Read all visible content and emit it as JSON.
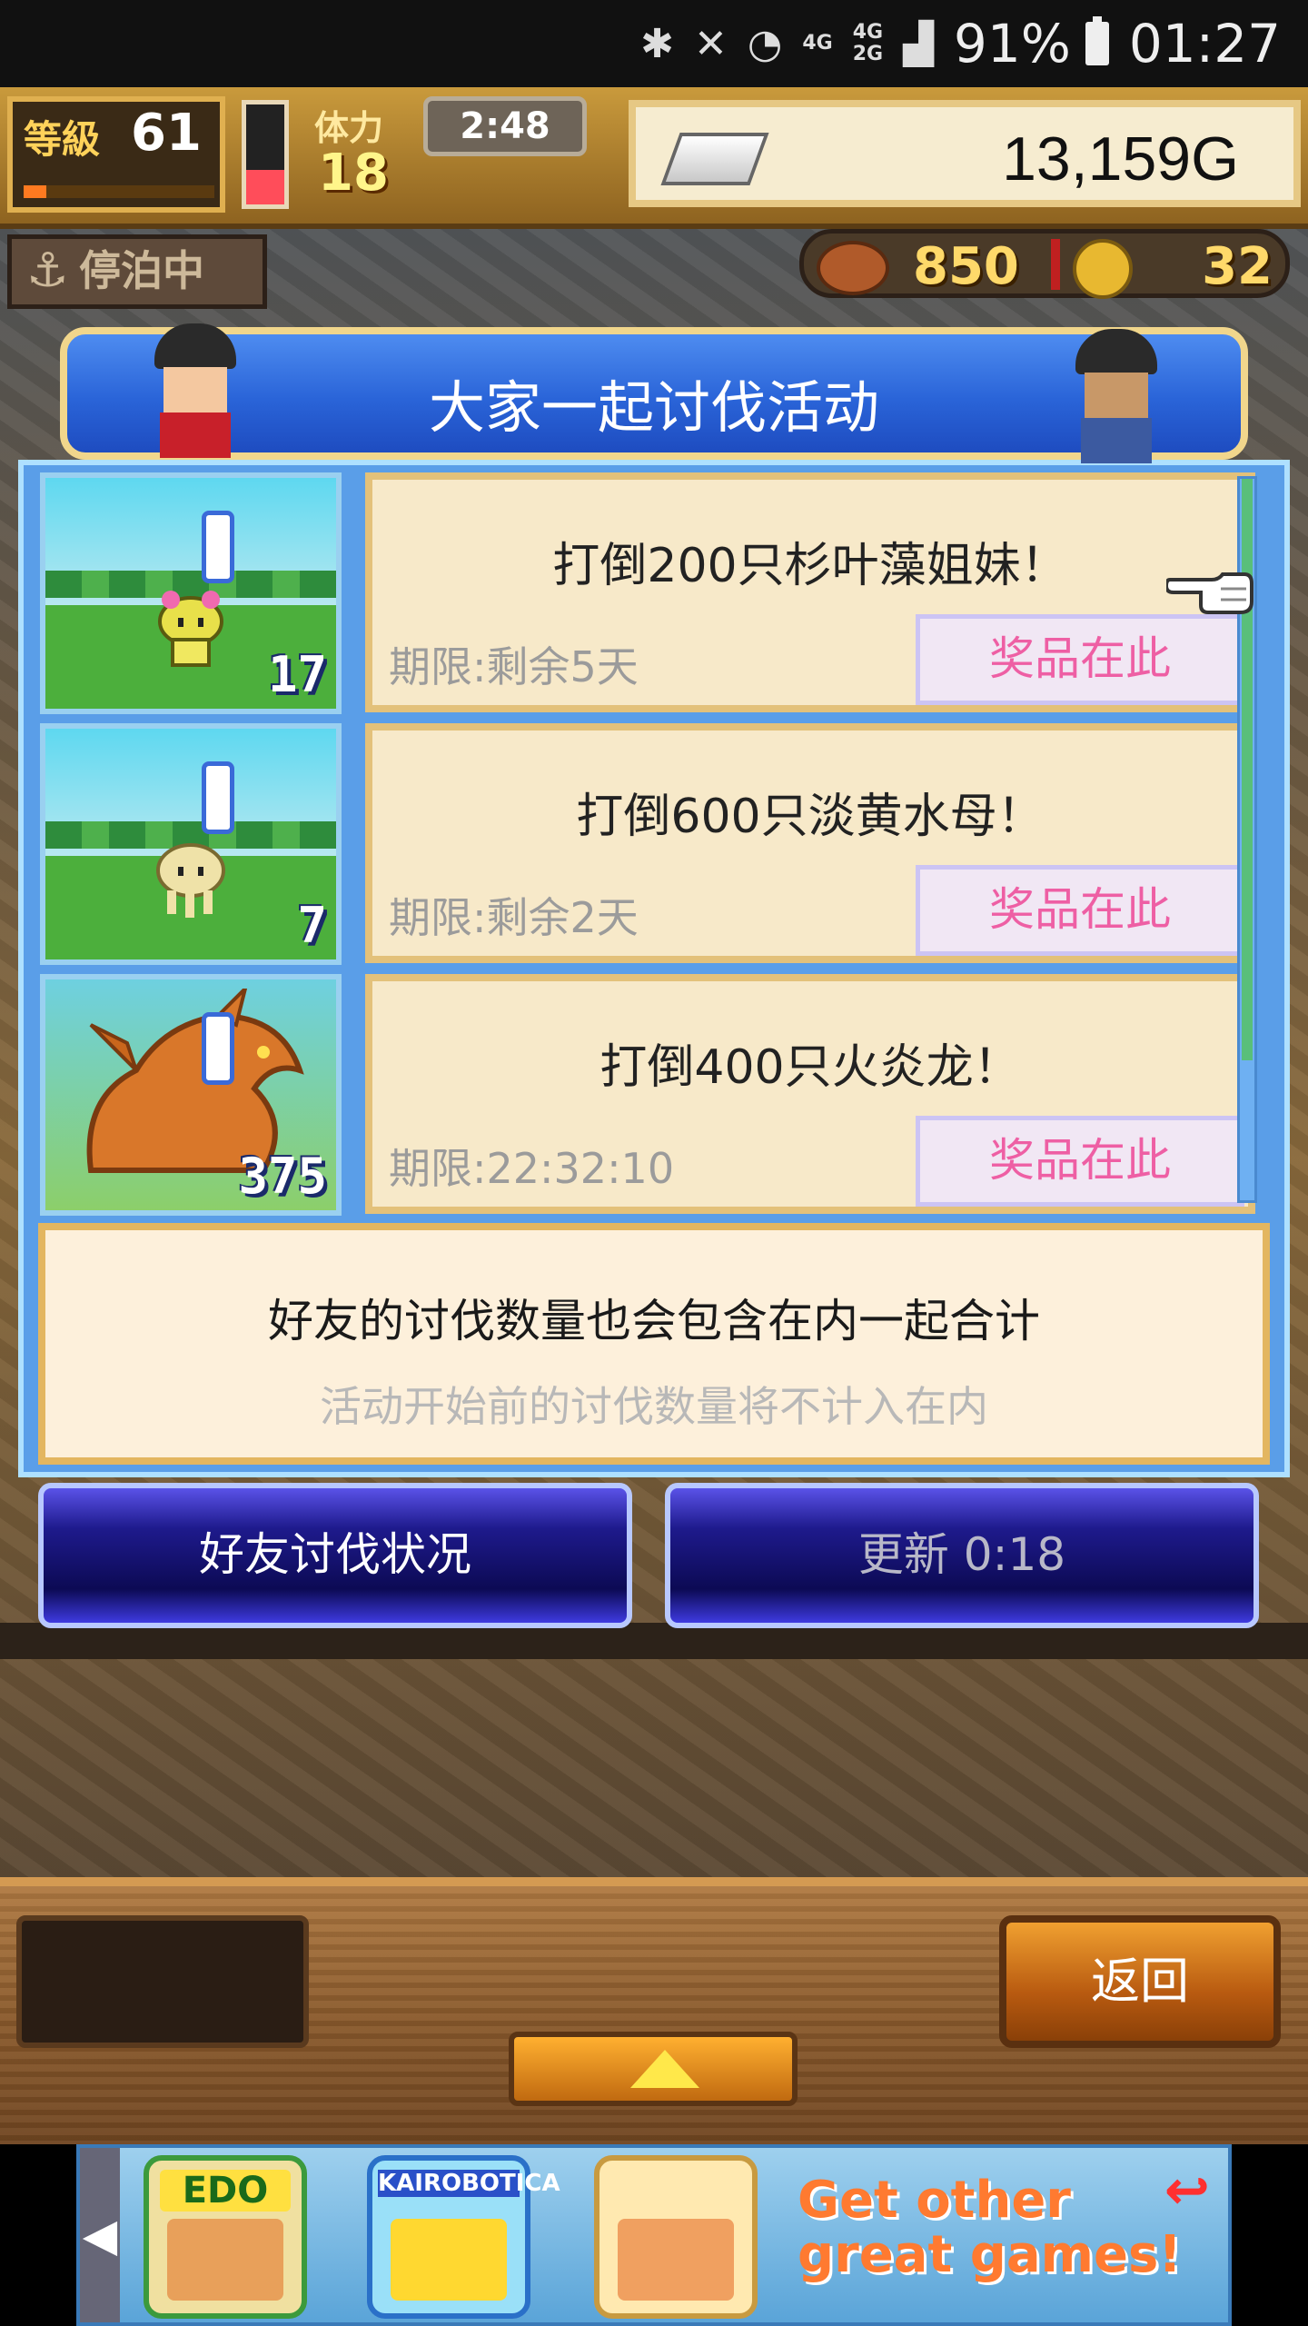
{
  "status_bar": {
    "signal_label": "4G",
    "signal_label_2": "4G",
    "signal_label_3": "2G",
    "battery": "91%",
    "time": "01:27"
  },
  "hud": {
    "level_label": "等級",
    "level": "61",
    "level_progress": 0.12,
    "stamina_label": "体力",
    "stamina": "18",
    "stamina_fill": 0.35,
    "timer": "2:48",
    "gold": "13,159G",
    "status": "停泊中",
    "food": "850",
    "medals": "32"
  },
  "event": {
    "title": "大家一起讨伐活动",
    "rows": [
      {
        "count": "17",
        "goal": "打倒200只杉叶藻姐妹！",
        "deadline": "期限:剩余5天",
        "prize": "奖品在此"
      },
      {
        "count": "7",
        "goal": "打倒600只淡黄水母！",
        "deadline": "期限:剩余2天",
        "prize": "奖品在此"
      },
      {
        "count": "375",
        "goal": "打倒400只火炎龙！",
        "deadline": "期限:22:32:10",
        "prize": "奖品在此"
      }
    ],
    "note_main": "好友的讨伐数量也会包含在内一起合计",
    "note_sub": "活动开始前的讨伐数量将不计入在内",
    "friend_button": "好友讨伐状况",
    "refresh_button": "更新 0:18"
  },
  "bottom": {
    "back_button": "返回"
  },
  "ad": {
    "tile1": "EDO",
    "tile2": "KAIROBOTICA",
    "cta_line1": "Get other",
    "cta_line2": "great games!"
  },
  "colors": {
    "panel_blue": "#5a9ee8",
    "card_bg": "#f7e9c9",
    "prize_text": "#ee5fa4",
    "button_navy": "#0c0a54"
  }
}
